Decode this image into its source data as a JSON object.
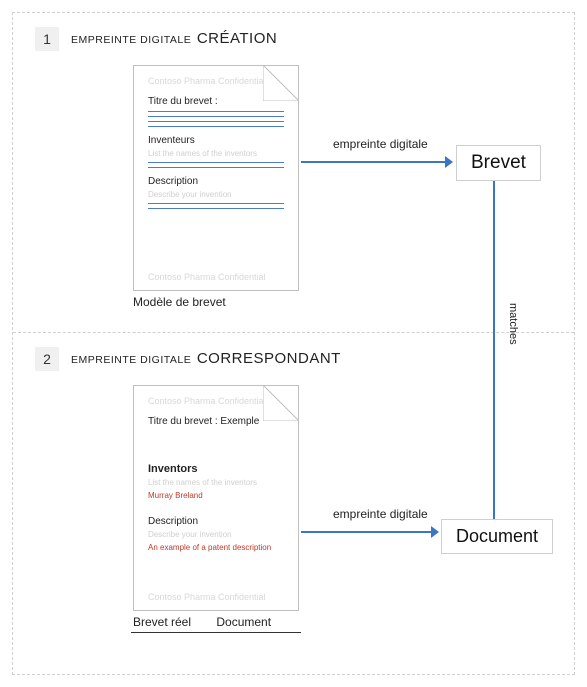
{
  "step1": {
    "number": "1",
    "labelSmall": "EMPREINTE DIGITALE",
    "labelBig": "CRÉATION",
    "doc": {
      "confidential": "Contoso Pharma Confidential",
      "titleLabel": "Titre du brevet :",
      "inventorsLabel": "Inventeurs",
      "inventorsHint": "List the names of the inventors",
      "descriptionLabel": "Description",
      "descriptionHint": "Describe your invention"
    },
    "docCaption": "Modèle de brevet",
    "arrowLabel": "empreinte digitale",
    "resultLabel": "Brevet"
  },
  "matchesLabel": "matches",
  "step2": {
    "number": "2",
    "labelSmall": "EMPREINTE DIGITALE",
    "labelBig": "CORRESPONDANT",
    "doc": {
      "confidential": "Contoso Pharma Confidential",
      "titleLabel": "Titre du brevet : Exemple",
      "inventorsLabel": "Inventors",
      "inventorsHint": "List the names of the inventors",
      "inventorsValue": "Murray Breland",
      "descriptionLabel": "Description",
      "descriptionHint": "Describe your invention",
      "descriptionValue": "An example of a patent description"
    },
    "docCaptionA": "Brevet réel",
    "docCaptionB": "Document",
    "arrowLabel": "empreinte digitale",
    "resultLabel": "Document"
  },
  "colors": {
    "arrow": "#3a77c2"
  }
}
